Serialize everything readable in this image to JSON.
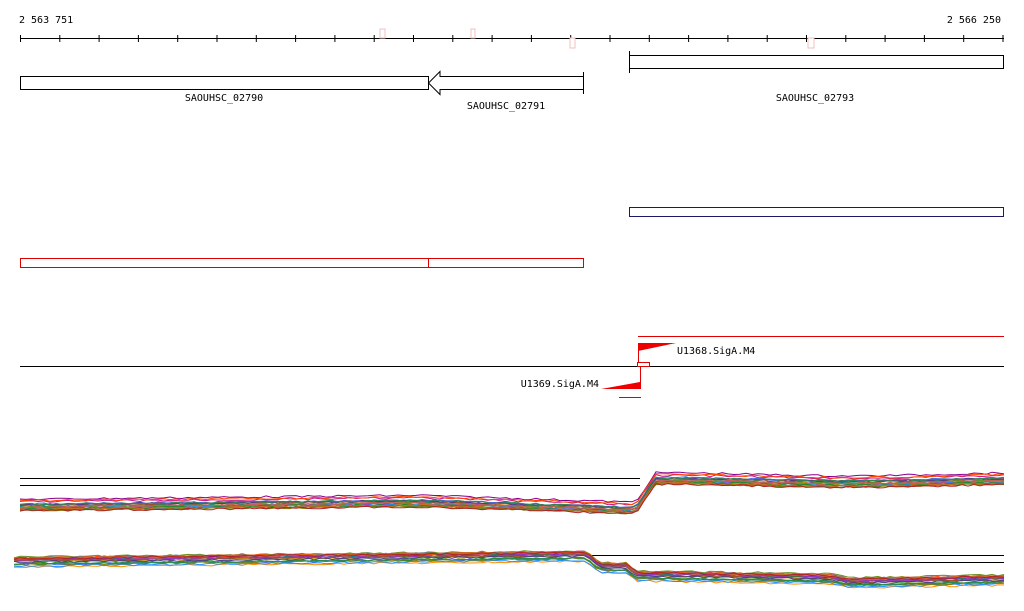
{
  "ruler": {
    "start": "2 563 751",
    "end": "2 566 250"
  },
  "genes": [
    {
      "name": "SAOUHSC_02790"
    },
    {
      "name": "SAOUHSC_02791"
    },
    {
      "name": "SAOUHSC_02793"
    }
  ],
  "promoters": [
    {
      "name": "U1368.SigA.M4",
      "strand": "+"
    },
    {
      "name": "U1369.SigA.M4",
      "strand": "-"
    }
  ],
  "colors": {
    "gene_outline": "#000000",
    "forward_transcript": "#1a1a66",
    "reverse_transcript": "#dd0000",
    "promoter": "#ee0000"
  }
}
